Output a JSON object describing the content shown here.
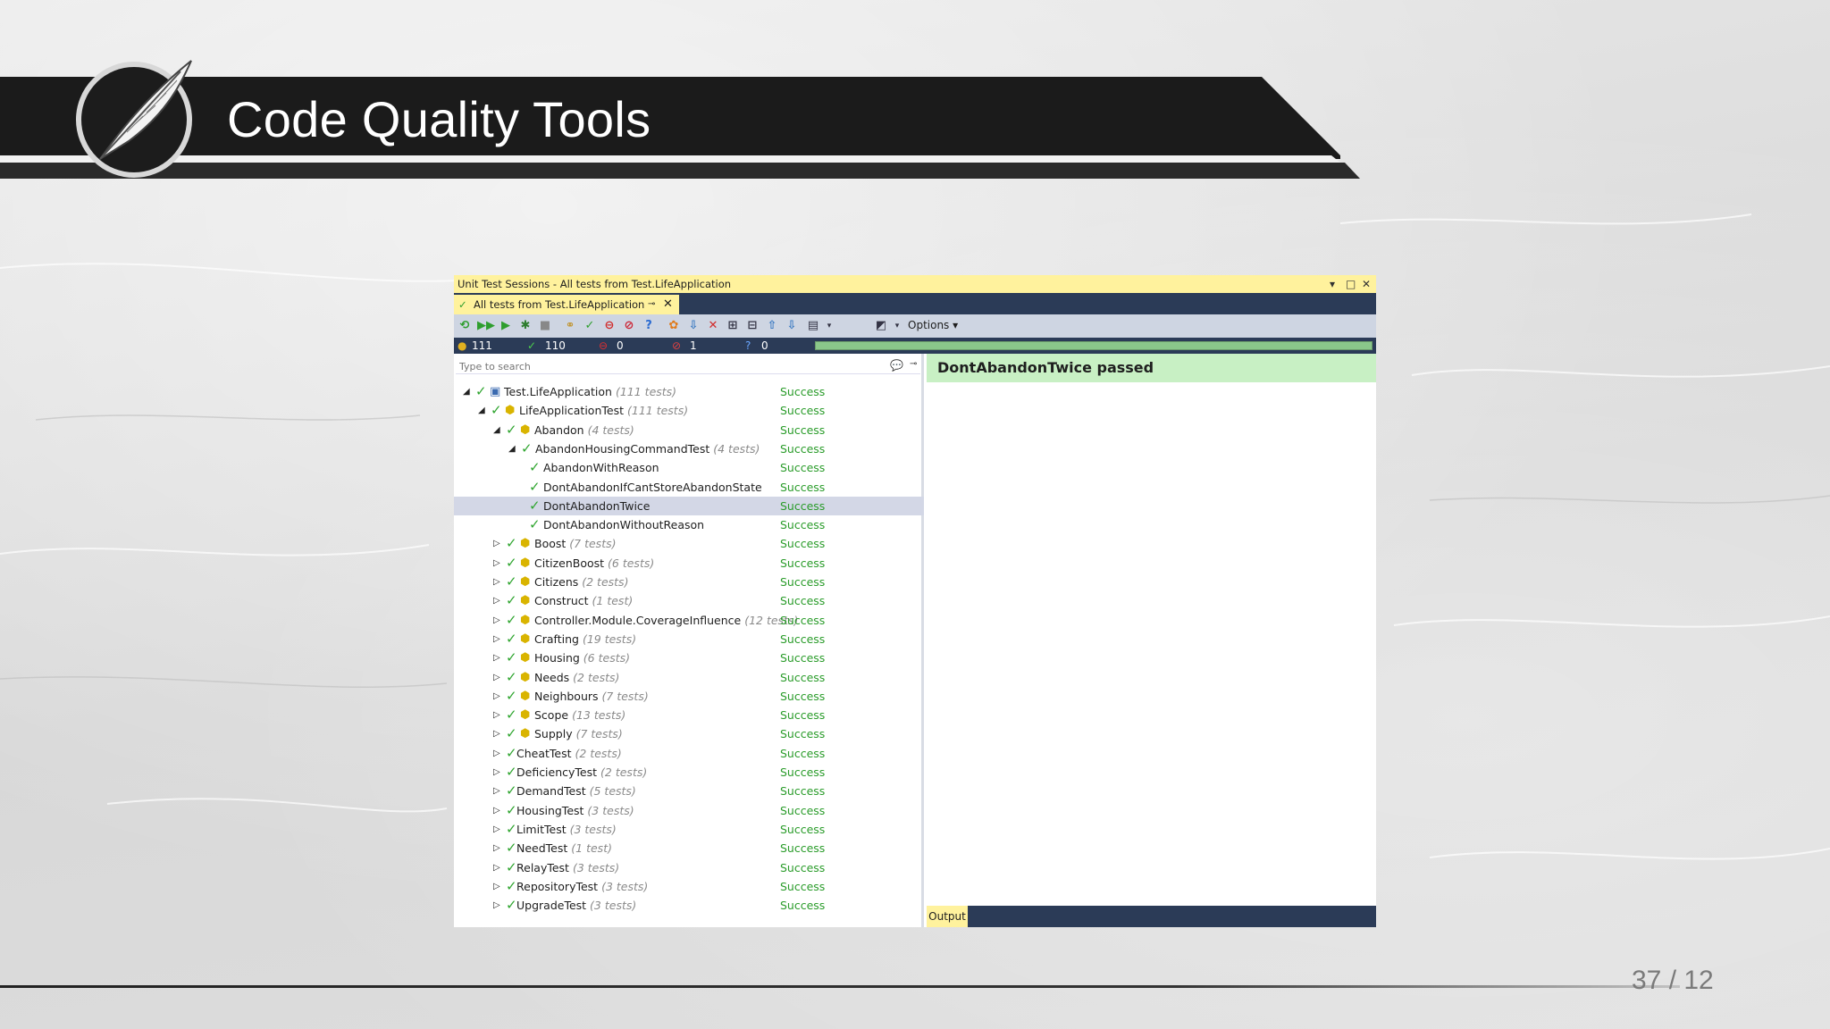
{
  "slide": {
    "title": "Code Quality Tools",
    "page_number": "37 / 12"
  },
  "window": {
    "title": "Unit Test Sessions - All tests from Test.LifeApplication",
    "tab_label": "All tests from Test.LifeApplication",
    "options_label": "Options",
    "counts": {
      "total": "111",
      "passed": "110",
      "failed": "0",
      "ignored": "1",
      "unknown": "0"
    },
    "progress_fraction": 1.0,
    "search_placeholder": "Type to search",
    "result_header": "DontAbandonTwice passed",
    "output_tab": "Output",
    "accent_colors": {
      "tab_yellow": "#fff29d",
      "dark_bar": "#2b3b57",
      "success_green": "#2a9c2a",
      "result_bg": "#c8f0c4"
    }
  },
  "tree": [
    {
      "name": "Test.LifeApplication",
      "count": "(111 tests)",
      "status": "Success",
      "level": 0,
      "arrow": "expanded",
      "icon": "project-icon"
    },
    {
      "name": "LifeApplicationTest",
      "count": "(111 tests)",
      "status": "Success",
      "level": 1,
      "arrow": "expanded",
      "icon": "namespace-icon"
    },
    {
      "name": "Abandon",
      "count": "(4 tests)",
      "status": "Success",
      "level": 2,
      "arrow": "expanded",
      "icon": "namespace-icon"
    },
    {
      "name": "AbandonHousingCommandTest",
      "count": "(4 tests)",
      "status": "Success",
      "level": 3,
      "arrow": "expanded",
      "icon": "none"
    },
    {
      "name": "AbandonWithReason",
      "count": "",
      "status": "Success",
      "level": 4,
      "arrow": "none",
      "icon": "none"
    },
    {
      "name": "DontAbandonIfCantStoreAbandonState",
      "count": "",
      "status": "Success",
      "level": 4,
      "arrow": "none",
      "icon": "none"
    },
    {
      "name": "DontAbandonTwice",
      "count": "",
      "status": "Success",
      "level": 4,
      "arrow": "none",
      "icon": "none",
      "selected": true
    },
    {
      "name": "DontAbandonWithoutReason",
      "count": "",
      "status": "Success",
      "level": 4,
      "arrow": "none",
      "icon": "none"
    },
    {
      "name": "Boost",
      "count": "(7 tests)",
      "status": "Success",
      "level": 2,
      "arrow": "collapsed",
      "icon": "namespace-icon"
    },
    {
      "name": "CitizenBoost",
      "count": "(6 tests)",
      "status": "Success",
      "level": 2,
      "arrow": "collapsed",
      "icon": "namespace-icon"
    },
    {
      "name": "Citizens",
      "count": "(2 tests)",
      "status": "Success",
      "level": 2,
      "arrow": "collapsed",
      "icon": "namespace-icon"
    },
    {
      "name": "Construct",
      "count": "(1 test)",
      "status": "Success",
      "level": 2,
      "arrow": "collapsed",
      "icon": "namespace-icon"
    },
    {
      "name": "Controller.Module.CoverageInfluence",
      "count": "(12 tests)",
      "status": "Success",
      "level": 2,
      "arrow": "collapsed",
      "icon": "namespace-icon"
    },
    {
      "name": "Crafting",
      "count": "(19 tests)",
      "status": "Success",
      "level": 2,
      "arrow": "collapsed",
      "icon": "namespace-icon"
    },
    {
      "name": "Housing",
      "count": "(6 tests)",
      "status": "Success",
      "level": 2,
      "arrow": "collapsed",
      "icon": "namespace-icon"
    },
    {
      "name": "Needs",
      "count": "(2 tests)",
      "status": "Success",
      "level": 2,
      "arrow": "collapsed",
      "icon": "namespace-icon"
    },
    {
      "name": "Neighbours",
      "count": "(7 tests)",
      "status": "Success",
      "level": 2,
      "arrow": "collapsed",
      "icon": "namespace-icon"
    },
    {
      "name": "Scope",
      "count": "(13 tests)",
      "status": "Success",
      "level": 2,
      "arrow": "collapsed",
      "icon": "namespace-icon"
    },
    {
      "name": "Supply",
      "count": "(7 tests)",
      "status": "Success",
      "level": 2,
      "arrow": "collapsed",
      "icon": "namespace-icon"
    },
    {
      "name": "CheatTest",
      "count": "(2 tests)",
      "status": "Success",
      "level": 2,
      "arrow": "collapsed",
      "icon": "none-shift"
    },
    {
      "name": "DeficiencyTest",
      "count": "(2 tests)",
      "status": "Success",
      "level": 2,
      "arrow": "collapsed",
      "icon": "none-shift"
    },
    {
      "name": "DemandTest",
      "count": "(5 tests)",
      "status": "Success",
      "level": 2,
      "arrow": "collapsed",
      "icon": "none-shift"
    },
    {
      "name": "HousingTest",
      "count": "(3 tests)",
      "status": "Success",
      "level": 2,
      "arrow": "collapsed",
      "icon": "none-shift"
    },
    {
      "name": "LimitTest",
      "count": "(3 tests)",
      "status": "Success",
      "level": 2,
      "arrow": "collapsed",
      "icon": "none-shift"
    },
    {
      "name": "NeedTest",
      "count": "(1 test)",
      "status": "Success",
      "level": 2,
      "arrow": "collapsed",
      "icon": "none-shift"
    },
    {
      "name": "RelayTest",
      "count": "(3 tests)",
      "status": "Success",
      "level": 2,
      "arrow": "collapsed",
      "icon": "none-shift"
    },
    {
      "name": "RepositoryTest",
      "count": "(3 tests)",
      "status": "Success",
      "level": 2,
      "arrow": "collapsed",
      "icon": "none-shift"
    },
    {
      "name": "UpgradeTest",
      "count": "(3 tests)",
      "status": "Success",
      "level": 2,
      "arrow": "collapsed",
      "icon": "none-shift"
    }
  ]
}
